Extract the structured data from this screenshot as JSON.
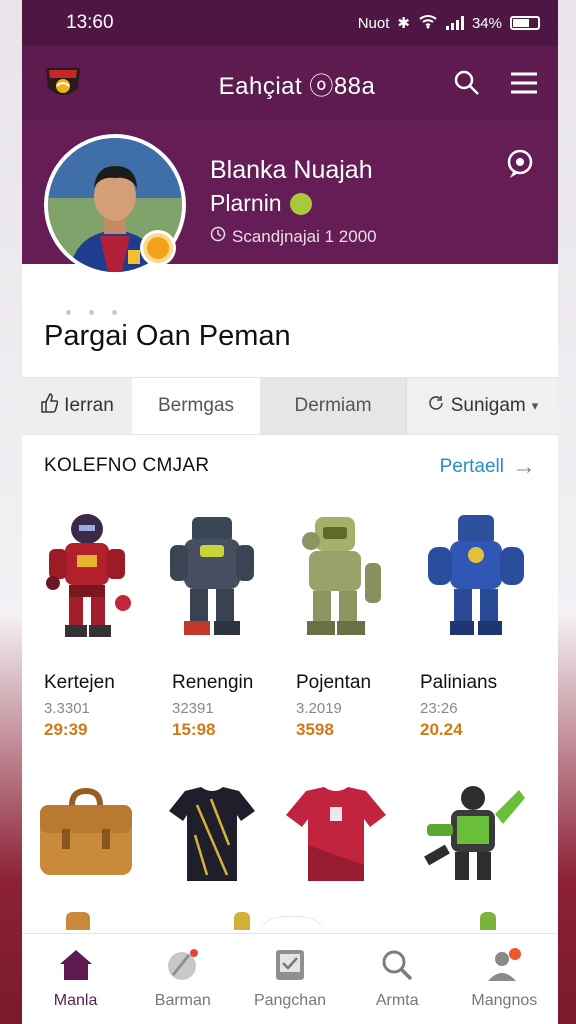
{
  "status_bar": {
    "time": "13:60",
    "carrier": "Nuot",
    "battery": "34%"
  },
  "app": {
    "title": "Eahçiat ⓞ88a"
  },
  "profile": {
    "name": "Blanka Nuajah",
    "role": "Plarnin",
    "meta": "Scandjnajai 1 2000"
  },
  "section": {
    "title": "Pargai Oan Peman"
  },
  "tabs": [
    {
      "label": "Ierran"
    },
    {
      "label": "Bermgas"
    },
    {
      "label": "Dermiam"
    },
    {
      "label": "Sunigam"
    }
  ],
  "collection": {
    "title": "KOLEFNO CMJAR",
    "link": "Pertaell",
    "items": [
      {
        "name": "Kertejen",
        "code": "3.3301",
        "price": "29:39",
        "icon": "red-robot-figure-icon"
      },
      {
        "name": "Renengin",
        "code": "32391",
        "price": "15:98",
        "icon": "dark-robot-figure-icon"
      },
      {
        "name": "Pojentan",
        "code": "3.2019",
        "price": "3598",
        "icon": "green-robot-figure-icon"
      },
      {
        "name": "Palinians",
        "code": "23:26",
        "price": "20.24",
        "icon": "blue-robot-figure-icon"
      }
    ],
    "row2": [
      {
        "icon": "leather-bag-icon"
      },
      {
        "icon": "black-gold-jersey-icon"
      },
      {
        "icon": "red-jersey-icon"
      },
      {
        "icon": "green-armor-figure-icon"
      }
    ]
  },
  "bottom_nav": [
    {
      "label": "Manla",
      "icon": "home-icon"
    },
    {
      "label": "Barman",
      "icon": "ball-icon"
    },
    {
      "label": "Pangchan",
      "icon": "tablet-icon"
    },
    {
      "label": "Armta",
      "icon": "search-icon"
    },
    {
      "label": "Mangnos",
      "icon": "profile-icon"
    }
  ],
  "colors": {
    "brand": "#5d1b50",
    "accent_price": "#d07a16",
    "link": "#2a8fc2"
  }
}
